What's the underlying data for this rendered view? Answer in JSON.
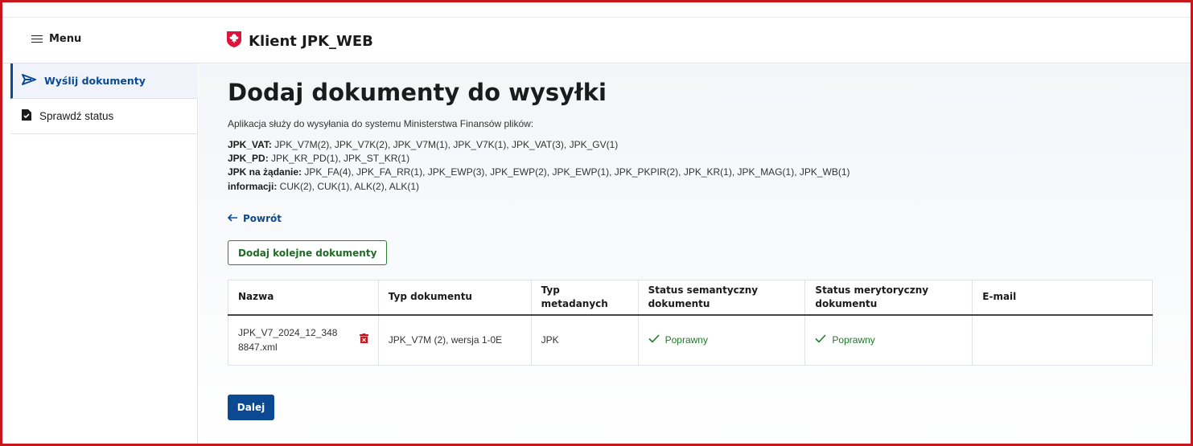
{
  "header": {
    "menu_label": "Menu",
    "app_title": "Klient JPK_WEB"
  },
  "sidebar": {
    "items": [
      {
        "label": "Wyślij dokumenty",
        "icon": "send-icon",
        "active": true
      },
      {
        "label": "Sprawdź status",
        "icon": "document-check-icon",
        "active": false
      }
    ]
  },
  "main": {
    "title": "Dodaj dokumenty do wysyłki",
    "intro": "Aplikacja służy do wysyłania do systemu Ministerstwa Finansów plików:",
    "doc_lines": [
      {
        "label": "JPK_VAT:",
        "value": " JPK_V7M(2), JPK_V7K(2), JPK_V7M(1), JPK_V7K(1), JPK_VAT(3), JPK_GV(1)"
      },
      {
        "label": "JPK_PD:",
        "value": " JPK_KR_PD(1), JPK_ST_KR(1)"
      },
      {
        "label": "JPK na żądanie:",
        "value": " JPK_FA(4), JPK_FA_RR(1), JPK_EWP(3), JPK_EWP(2), JPK_EWP(1), JPK_PKPIR(2), JPK_KR(1), JPK_MAG(1), JPK_WB(1)"
      },
      {
        "label": "informacji:",
        "value": " CUK(2), CUK(1), ALK(2), ALK(1)"
      }
    ],
    "back_label": "Powrót",
    "add_button": "Dodaj kolejne dokumenty",
    "next_button": "Dalej"
  },
  "table": {
    "headers": [
      "Nazwa",
      "Typ dokumentu",
      "Typ metadanych",
      "Status semantyczny dokumentu",
      "Status merytoryczny dokumentu",
      "E-mail"
    ],
    "rows": [
      {
        "name": "JPK_V7_2024_12_3488847.xml",
        "doc_type": "JPK_V7M (2), wersja 1-0E",
        "meta_type": "JPK",
        "semantic_status": "Poprawny",
        "merit_status": "Poprawny",
        "email": ""
      }
    ]
  },
  "colors": {
    "accent": "#0b4a93",
    "success": "#2e7d32",
    "frame": "#c8161d",
    "delete": "#c8161d"
  }
}
